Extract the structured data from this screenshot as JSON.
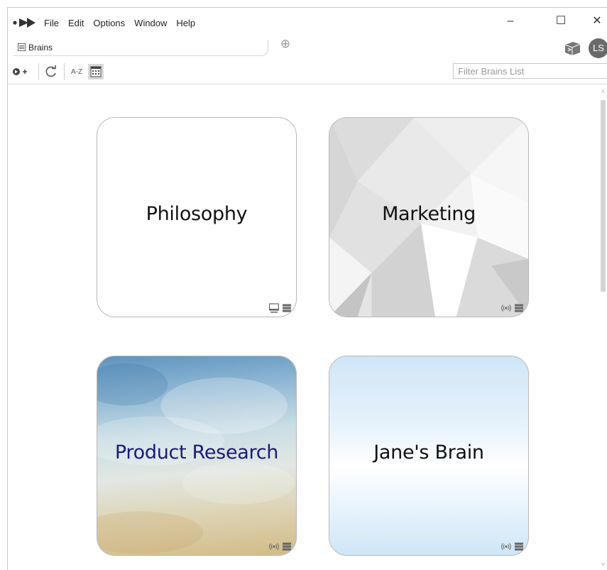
{
  "menu": [
    "File",
    "Edit",
    "Options",
    "Window",
    "Help"
  ],
  "window_controls": {
    "minimize": "–",
    "maximize": "☐",
    "close": "✕"
  },
  "tab": {
    "label": "Brains",
    "add_symbol": "⊕"
  },
  "user": {
    "initials": "LS"
  },
  "toolbar": {
    "sort_label": "A-Z",
    "filter_placeholder": "Filter Brains List"
  },
  "brains": [
    {
      "name": "Philosophy",
      "title_color": "#111111",
      "location": "local",
      "icons": [
        "computer-icon",
        "menu-icon"
      ]
    },
    {
      "name": "Marketing",
      "title_color": "#111111",
      "location": "cloud",
      "icons": [
        "sync-icon",
        "menu-icon"
      ]
    },
    {
      "name": "Product Research",
      "title_color": "#1a1a7a",
      "location": "cloud",
      "icons": [
        "sync-icon",
        "menu-icon"
      ]
    },
    {
      "name": "Jane's Brain",
      "title_color": "#111111",
      "location": "cloud",
      "icons": [
        "sync-icon",
        "menu-icon"
      ]
    }
  ],
  "colors": {
    "avatar_bg": "#6a6a6a",
    "card_border": "#b9b9b9",
    "scrollbar_thumb": "#d4d4d4"
  }
}
